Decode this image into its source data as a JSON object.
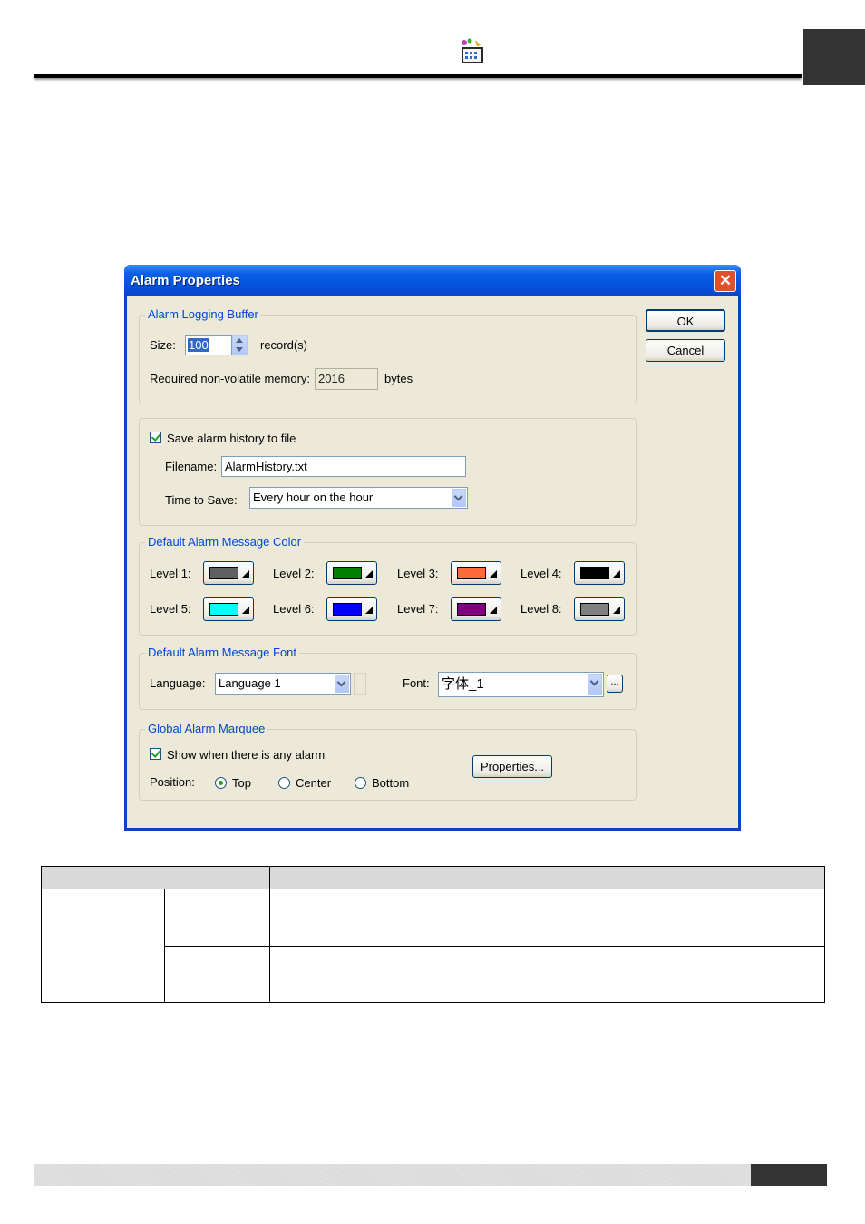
{
  "dialog": {
    "title": "Alarm Properties",
    "ok_label": "OK",
    "cancel_label": "Cancel",
    "buffer_group": {
      "label": "Alarm Logging Buffer",
      "size_label": "Size:",
      "size_value": "100",
      "records_label": "record(s)",
      "memory_label": "Required non-volatile memory:",
      "memory_value": "2016",
      "bytes_label": "bytes"
    },
    "save_group": {
      "save_label": "Save alarm history to file",
      "save_checked": true,
      "filename_label": "Filename:",
      "filename_value": "AlarmHistory.txt",
      "time_label": "Time to Save:",
      "time_value": "Every hour on the hour"
    },
    "color_group": {
      "label": "Default Alarm Message Color",
      "levels": [
        {
          "label": "Level 1:",
          "color": "#606060"
        },
        {
          "label": "Level 2:",
          "color": "#008000"
        },
        {
          "label": "Level 3:",
          "color": "#ff6a3a"
        },
        {
          "label": "Level 4:",
          "color": "#000000"
        },
        {
          "label": "Level 5:",
          "color": "#00ffff"
        },
        {
          "label": "Level 6:",
          "color": "#0000ff"
        },
        {
          "label": "Level 7:",
          "color": "#800080"
        },
        {
          "label": "Level 8:",
          "color": "#808080"
        }
      ]
    },
    "font_group": {
      "label": "Default Alarm Message Font",
      "language_label": "Language:",
      "language_value": "Language 1",
      "font_label": "Font:",
      "font_value": "字体_1",
      "browse_label": "..."
    },
    "marquee_group": {
      "label": "Global Alarm Marquee",
      "show_label": "Show when there is any alarm",
      "show_checked": true,
      "properties_label": "Properties...",
      "position_label": "Position:",
      "positions": [
        {
          "label": "Top",
          "selected": true
        },
        {
          "label": "Center",
          "selected": false
        },
        {
          "label": "Bottom",
          "selected": false
        }
      ]
    }
  },
  "colors": {
    "title_bar": "#0a5ee6",
    "dialog_bg": "#ece9d8",
    "group_label": "#0046d5",
    "close_button": "#e0502a",
    "page_tab": "#333333"
  }
}
